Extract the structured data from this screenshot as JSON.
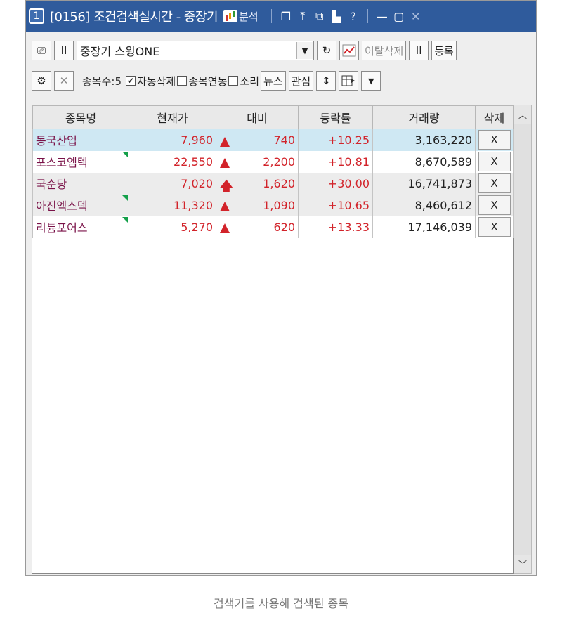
{
  "titlebar": {
    "window_number": "1",
    "title": "[0156] 조건검색실시간 - 중장기",
    "analysis_label": "분석",
    "icons": [
      "window-restore-icon",
      "pin-top-icon",
      "window-split-icon",
      "lock-icon",
      "help-icon",
      "minimize-icon",
      "maximize-icon",
      "close-icon"
    ],
    "help_glyph": "?"
  },
  "toolbar1": {
    "condition_select": "중장기 스윙ONE",
    "pause_label": "II",
    "refresh_glyph": "↻",
    "deviation_delete_label": "이탈삭제",
    "pause2_label": "II",
    "register_label": "등록"
  },
  "toolbar2": {
    "count_label": "종목수:5",
    "auto_delete_label": "자동삭제",
    "auto_delete_checked": true,
    "stock_link_label": "종목연동",
    "stock_link_checked": false,
    "sound_label": "소리",
    "sound_checked": false,
    "news_label": "뉴스",
    "interest_label": "관심",
    "sort_glyph": "↕"
  },
  "table": {
    "headers": [
      "종목명",
      "현재가",
      "대비",
      "등락률",
      "거래량",
      "삭제"
    ],
    "rows": [
      {
        "name": "동국산업",
        "price": "7,960",
        "change": "740",
        "indicator": "triangle-up",
        "rate": "+10.25",
        "volume": "3,163,220",
        "delete": "X",
        "flag": false
      },
      {
        "name": "포스코엠텍",
        "price": "22,550",
        "change": "2,200",
        "indicator": "triangle-up",
        "rate": "+10.81",
        "volume": "8,670,589",
        "delete": "X",
        "flag": true
      },
      {
        "name": "국순당",
        "price": "7,020",
        "change": "1,620",
        "indicator": "arrow-up",
        "rate": "+30.00",
        "volume": "16,741,873",
        "delete": "X",
        "flag": false
      },
      {
        "name": "아진엑스텍",
        "price": "11,320",
        "change": "1,090",
        "indicator": "triangle-up",
        "rate": "+10.65",
        "volume": "8,460,612",
        "delete": "X",
        "flag": true
      },
      {
        "name": "리튬포어스",
        "price": "5,270",
        "change": "620",
        "indicator": "triangle-up",
        "rate": "+13.33",
        "volume": "17,146,039",
        "delete": "X",
        "flag": true
      }
    ]
  },
  "caption": "검색기를 사용해 검색된 종목",
  "colors": {
    "titlebar": "#2f5b9c",
    "selected_row": "#cfe8f3",
    "stock_name": "#7a1248",
    "rise": "#d2232a",
    "new_flag": "#14a04a"
  }
}
